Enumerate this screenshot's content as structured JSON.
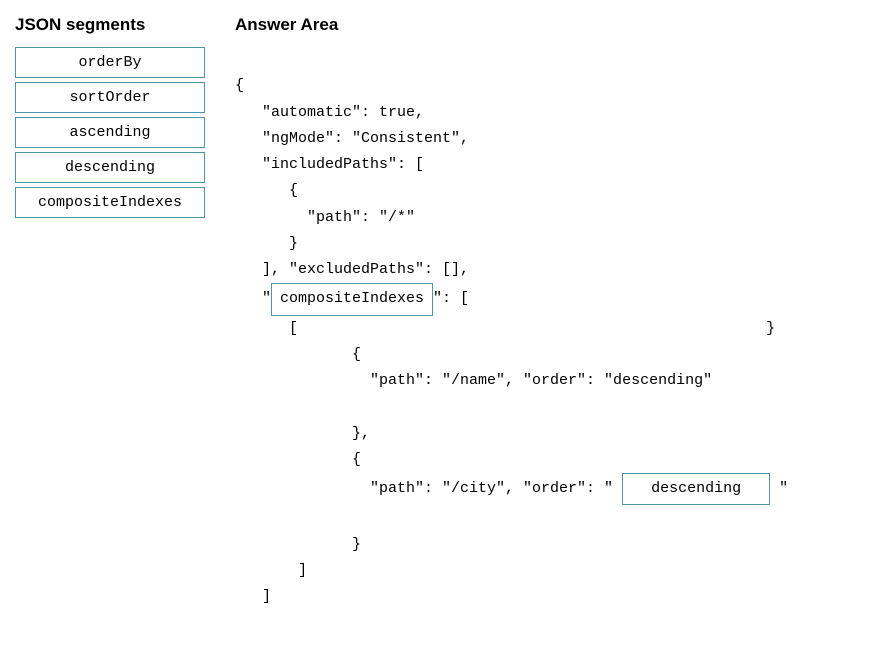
{
  "left": {
    "header": "JSON segments",
    "segments": [
      "orderBy",
      "sortOrder",
      "ascending",
      "descending",
      "compositeIndexes"
    ]
  },
  "right": {
    "header": "Answer Area",
    "code": {
      "l0": "{",
      "l1": "   \"automatic\": true,",
      "l2": "   \"ngMode\": \"Consistent\",",
      "l3": "   \"includedPaths\": [",
      "l4": "      {",
      "l5": "        \"path\": \"/*\"",
      "l6": "      }",
      "l7": "   ], \"excludedPaths\": [],",
      "l8a": "   \"",
      "box1": "compositeIndexes",
      "l8b": "\": [",
      "l9": "      [",
      "l9end": "}",
      "l10": "             {",
      "l11": "               \"path\": \"/name\", \"order\": \"descending\"",
      "l12": "",
      "l13": "             },",
      "l14": "             {",
      "l15a": "               \"path\": \"/city\", \"order\": \" ",
      "box2": "descending",
      "l15b": " \"",
      "l16": "",
      "l17": "             }",
      "l18": "       ]",
      "l19": "   ]"
    }
  }
}
